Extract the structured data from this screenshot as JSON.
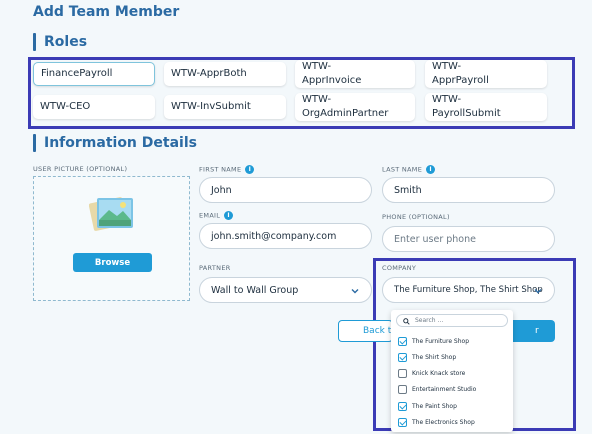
{
  "page": {
    "title": "Add Team Member"
  },
  "roles": {
    "title": "Roles",
    "items": [
      {
        "label": "FinancePayroll",
        "selected": true
      },
      {
        "label": "WTW-ApprBoth",
        "selected": false
      },
      {
        "label": "WTW-\nApprInvoice",
        "selected": false
      },
      {
        "label": "WTW-\nApprPayroll",
        "selected": false
      },
      {
        "label": "WTW-CEO",
        "selected": false
      },
      {
        "label": "WTW-InvSubmit",
        "selected": false
      },
      {
        "label": "WTW-\nOrgAdminPartner",
        "selected": false
      },
      {
        "label": "WTW-\nPayrollSubmit",
        "selected": false
      }
    ]
  },
  "info": {
    "title": "Information Details",
    "user_picture_label": "USER PICTURE (OPTIONAL)",
    "browse_label": "Browse",
    "first_name_label": "FIRST NAME",
    "first_name_value": "John",
    "last_name_label": "LAST NAME",
    "last_name_value": "Smith",
    "email_label": "EMAIL",
    "email_value": "john.smith@company.com",
    "phone_label": "PHONE (OPTIONAL)",
    "phone_placeholder": "Enter user phone",
    "partner_label": "PARTNER",
    "partner_value": "Wall to Wall Group",
    "company_label": "COMPANY",
    "company_value": "The Furniture Shop, The Shirt Shop, T..."
  },
  "buttons": {
    "back_label": "Back t",
    "submit_label": "r"
  },
  "company_dropdown": {
    "search_placeholder": "Search ...",
    "options": [
      {
        "label": "The Furniture Shop",
        "checked": true
      },
      {
        "label": "The Shirt Shop",
        "checked": true
      },
      {
        "label": "Knick Knack store",
        "checked": false
      },
      {
        "label": "Entertainment Studio",
        "checked": false
      },
      {
        "label": "The Paint Shop",
        "checked": true
      },
      {
        "label": "The Electronics Shop",
        "checked": true
      }
    ]
  },
  "colors": {
    "accent": "#1f9bd6",
    "heading": "#2b6aa3",
    "highlight_box": "#3b3bb5"
  }
}
